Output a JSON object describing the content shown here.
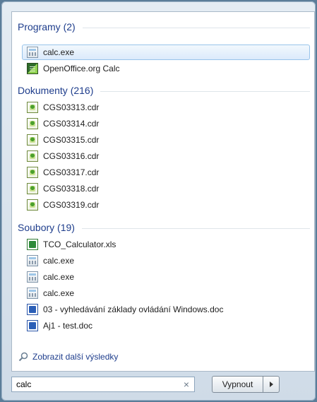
{
  "groups": [
    {
      "title": "Programy (2)",
      "items": [
        {
          "label": "calc.exe",
          "icon": "calculator-icon"
        },
        {
          "label": "OpenOffice.org Calc",
          "icon": "openoffice-calc-icon"
        }
      ]
    },
    {
      "title": "Dokumenty (216)",
      "items": [
        {
          "label": "CGS03313.cdr",
          "icon": "cdr-file-icon"
        },
        {
          "label": "CGS03314.cdr",
          "icon": "cdr-file-icon"
        },
        {
          "label": "CGS03315.cdr",
          "icon": "cdr-file-icon"
        },
        {
          "label": "CGS03316.cdr",
          "icon": "cdr-file-icon"
        },
        {
          "label": "CGS03317.cdr",
          "icon": "cdr-file-icon"
        },
        {
          "label": "CGS03318.cdr",
          "icon": "cdr-file-icon"
        },
        {
          "label": "CGS03319.cdr",
          "icon": "cdr-file-icon"
        }
      ]
    },
    {
      "title": "Soubory (19)",
      "items": [
        {
          "label": "TCO_Calculator.xls",
          "icon": "excel-file-icon"
        },
        {
          "label": "calc.exe",
          "icon": "calculator-icon"
        },
        {
          "label": "calc.exe",
          "icon": "calculator-icon"
        },
        {
          "label": "calc.exe",
          "icon": "calculator-icon"
        },
        {
          "label": "03 - vyhledávání základy ovládání Windows.doc",
          "icon": "word-file-icon"
        },
        {
          "label": "Aj1 - test.doc",
          "icon": "word-file-icon"
        }
      ]
    }
  ],
  "more_results": "Zobrazit další výsledky",
  "search": {
    "value": "calc",
    "clear_symbol": "×"
  },
  "shutdown": {
    "label": "Vypnout"
  },
  "colors": {
    "group_title": "#1e3d8c",
    "selection_border": "#98c3ea"
  }
}
